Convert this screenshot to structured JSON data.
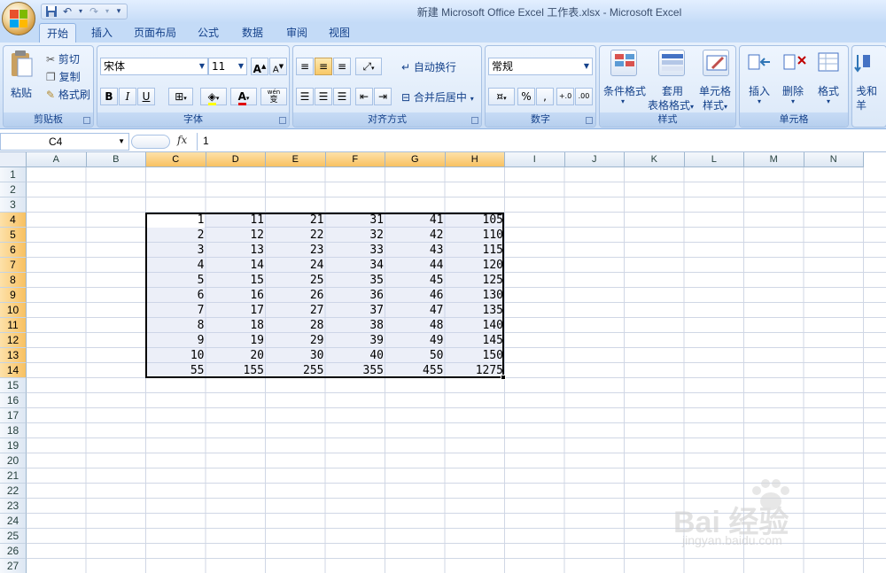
{
  "window": {
    "title": "新建 Microsoft Office Excel 工作表.xlsx - Microsoft Excel"
  },
  "quick_access": {
    "icons": [
      "save-icon",
      "undo-icon",
      "redo-icon",
      "customize-icon"
    ]
  },
  "tabs": [
    {
      "label": "开始",
      "active": true
    },
    {
      "label": "插入",
      "active": false
    },
    {
      "label": "页面布局",
      "active": false
    },
    {
      "label": "公式",
      "active": false
    },
    {
      "label": "数据",
      "active": false
    },
    {
      "label": "审阅",
      "active": false
    },
    {
      "label": "视图",
      "active": false
    }
  ],
  "ribbon": {
    "clipboard": {
      "paste": "粘贴",
      "cut": "剪切",
      "copy": "复制",
      "format_painter": "格式刷",
      "label": "剪贴板"
    },
    "font": {
      "name": "宋体",
      "size": "11",
      "bold": "B",
      "italic": "I",
      "underline": "U",
      "wubi": "wén",
      "phonetic": "变",
      "label": "字体"
    },
    "alignment": {
      "wrap": "自动换行",
      "merge": "合并后居中",
      "label": "对齐方式"
    },
    "number": {
      "format": "常规",
      "percent": "%",
      "comma": ",",
      "label": "数字"
    },
    "styles": {
      "conditional": "条件格式",
      "table_line1": "套用",
      "table_line2": "表格格式",
      "cell_line1": "单元格",
      "cell_line2": "样式",
      "label": "样式"
    },
    "cells": {
      "insert": "插入",
      "delete": "删除",
      "format": "格式",
      "label": "单元格"
    },
    "editing": {
      "partial_line1": "戋和",
      "partial_line2": "羊"
    }
  },
  "formula_bar": {
    "name_box": "C4",
    "fx": "fx",
    "value": "1"
  },
  "sheet": {
    "columns": [
      "A",
      "B",
      "C",
      "D",
      "E",
      "F",
      "G",
      "H",
      "I",
      "J",
      "K",
      "L",
      "M",
      "N"
    ],
    "selected_columns": [
      "C",
      "D",
      "E",
      "F",
      "G",
      "H"
    ],
    "rows": [
      "1",
      "2",
      "3",
      "4",
      "5",
      "6",
      "7",
      "8",
      "9",
      "10",
      "11",
      "12",
      "13",
      "14",
      "15",
      "16",
      "17",
      "18",
      "19",
      "20",
      "21",
      "22",
      "23",
      "24",
      "25",
      "26",
      "27"
    ],
    "selected_rows": [
      "4",
      "5",
      "6",
      "7",
      "8",
      "9",
      "10",
      "11",
      "12",
      "13",
      "14"
    ],
    "data": [
      [
        "1",
        "11",
        "21",
        "31",
        "41",
        "105"
      ],
      [
        "2",
        "12",
        "22",
        "32",
        "42",
        "110"
      ],
      [
        "3",
        "13",
        "23",
        "33",
        "43",
        "115"
      ],
      [
        "4",
        "14",
        "24",
        "34",
        "44",
        "120"
      ],
      [
        "5",
        "15",
        "25",
        "35",
        "45",
        "125"
      ],
      [
        "6",
        "16",
        "26",
        "36",
        "46",
        "130"
      ],
      [
        "7",
        "17",
        "27",
        "37",
        "47",
        "135"
      ],
      [
        "8",
        "18",
        "28",
        "38",
        "48",
        "140"
      ],
      [
        "9",
        "19",
        "29",
        "39",
        "49",
        "145"
      ],
      [
        "10",
        "20",
        "30",
        "40",
        "50",
        "150"
      ],
      [
        "55",
        "155",
        "255",
        "355",
        "455",
        "1275"
      ]
    ]
  },
  "watermark": {
    "text": "Bai 经验",
    "sub": "jingyan.baidu.com"
  }
}
